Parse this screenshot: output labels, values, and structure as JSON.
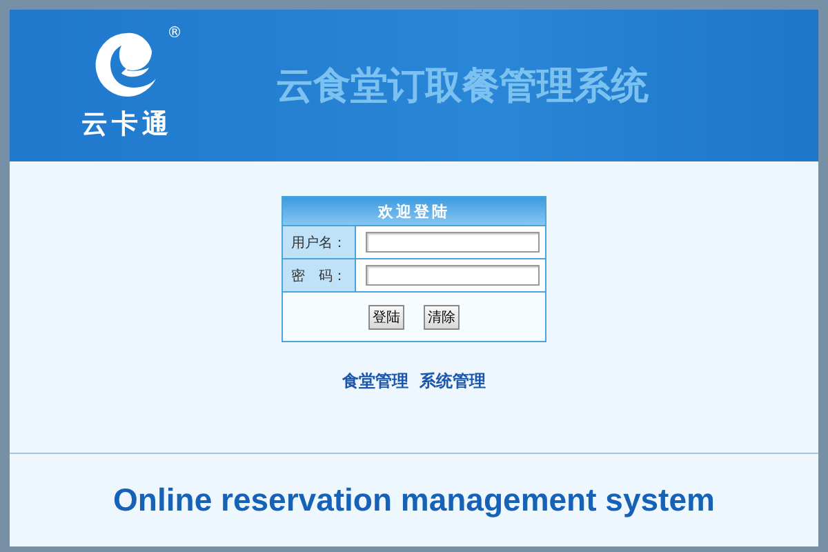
{
  "header": {
    "logo_text": "云卡通",
    "registered_mark": "®",
    "title": "云食堂订取餐管理系统"
  },
  "login": {
    "title": "欢迎登陆",
    "fields": [
      {
        "label": "用户名："
      },
      {
        "label": "密　码："
      }
    ],
    "buttons": [
      "登陆",
      "清除"
    ]
  },
  "links": [
    "食堂管理",
    "系统管理"
  ],
  "footer": {
    "caption": "Online reservation management system"
  }
}
